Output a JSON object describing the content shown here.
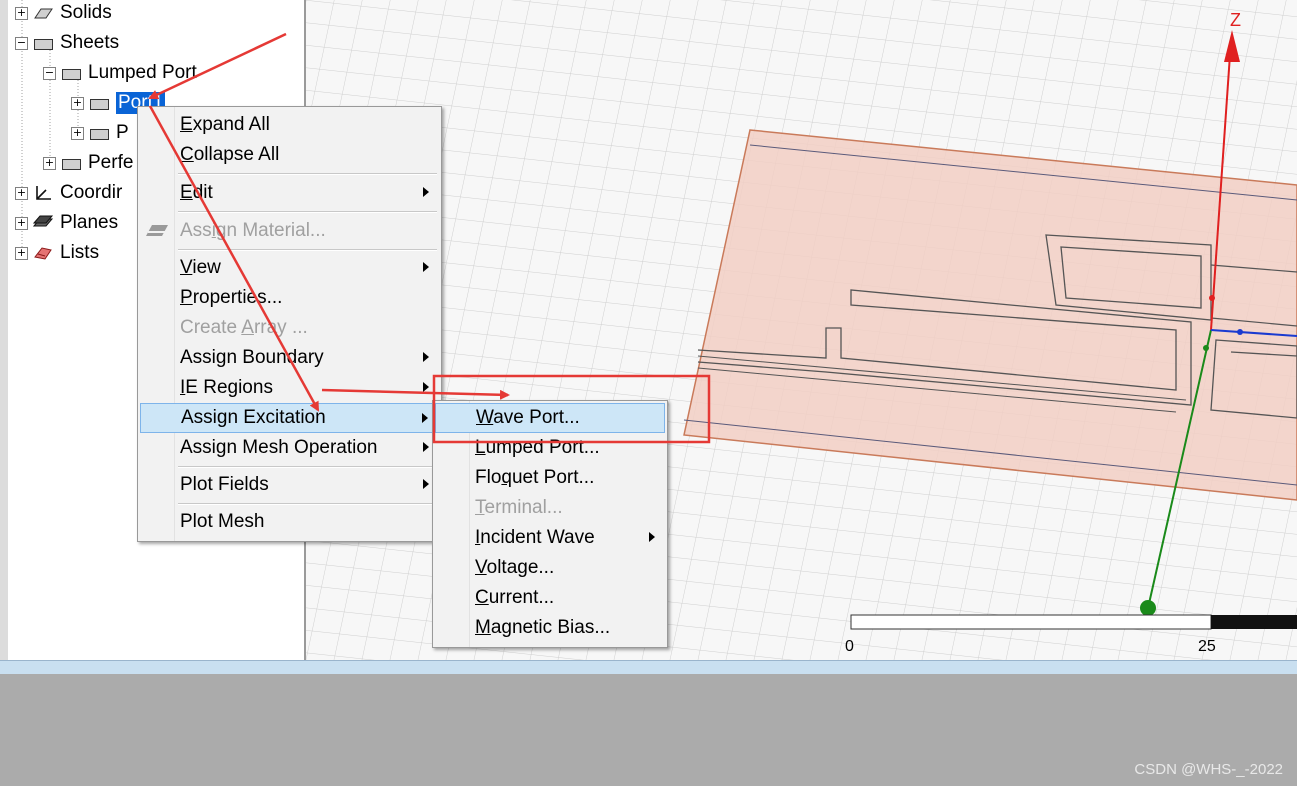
{
  "tree": {
    "items": [
      {
        "label": "Solids",
        "expander": "+"
      },
      {
        "label": "Sheets",
        "expander": "−"
      },
      {
        "label": "Lumped Port",
        "expander": "−"
      },
      {
        "label": "Port1",
        "expander": "+"
      },
      {
        "label": "P",
        "expander": "+"
      },
      {
        "label": "Perfe",
        "expander": "+"
      },
      {
        "label": "Coordir",
        "expander": "+"
      },
      {
        "label": "Planes",
        "expander": "+"
      },
      {
        "label": "Lists",
        "expander": "+"
      }
    ]
  },
  "context_menu": {
    "items": [
      {
        "label": "Expand All",
        "mnemonic": "E",
        "rest": "xpand All"
      },
      {
        "label": "Collapse All",
        "mnemonic": "C",
        "rest": "ollapse All"
      },
      {
        "label": "Edit",
        "mnemonic": "E",
        "rest": "dit"
      },
      {
        "label": "Assign Material...",
        "pre": "Ass",
        "mnemonic": "i",
        "rest": "gn Material..."
      },
      {
        "label": "View",
        "mnemonic": "V",
        "rest": "iew"
      },
      {
        "label": "Properties...",
        "mnemonic": "P",
        "rest": "roperties..."
      },
      {
        "label": "Create Array ...",
        "pre": "Create ",
        "mnemonic": "A",
        "rest": "rray ..."
      },
      {
        "label": "Assign Boundary"
      },
      {
        "label": "IE Regions",
        "mnemonic": "I",
        "rest": "E Regions"
      },
      {
        "label": "Assign Excitation"
      },
      {
        "label": "Assign Mesh Operation"
      },
      {
        "label": "Plot Fields"
      },
      {
        "label": "Plot Mesh"
      }
    ]
  },
  "submenu": {
    "items": [
      {
        "label": "Wave Port...",
        "mnemonic": "W",
        "rest": "ave Port..."
      },
      {
        "label": "Lumped Port...",
        "mnemonic": "L",
        "rest": "umped Port..."
      },
      {
        "label": "Floquet Port...",
        "pre": "Flo",
        "mnemonic": "q",
        "rest": "uet Port..."
      },
      {
        "label": "Terminal...",
        "mnemonic": "T",
        "rest": "erminal..."
      },
      {
        "label": "Incident Wave",
        "mnemonic": "I",
        "rest": "ncident Wave"
      },
      {
        "label": "Voltage...",
        "mnemonic": "V",
        "rest": "oltage..."
      },
      {
        "label": "Current...",
        "mnemonic": "C",
        "rest": "urrent..."
      },
      {
        "label": "Magnetic Bias...",
        "mnemonic": "M",
        "rest": "agnetic Bias..."
      }
    ]
  },
  "viewport": {
    "axis_label": "Z",
    "scale_start": "0",
    "scale_mid": "25"
  },
  "watermark": "CSDN @WHS-_-2022",
  "colors": {
    "highlight": "#cde6f7",
    "annotation_red": "#e53935",
    "port_fill": "#f2cfc4"
  }
}
